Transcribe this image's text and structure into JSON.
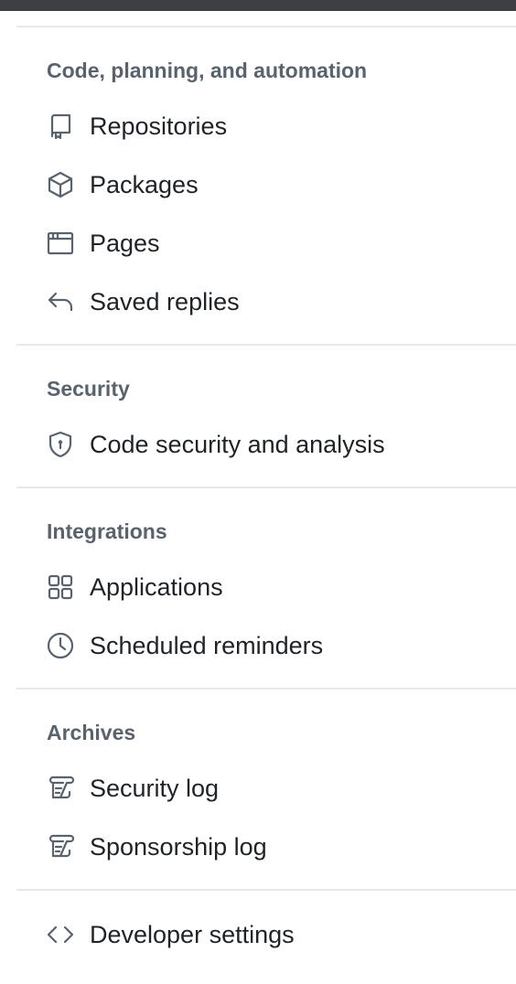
{
  "sections": {
    "code": {
      "heading": "Code, planning, and automation",
      "items": [
        {
          "label": "Repositories",
          "icon": "repo-icon"
        },
        {
          "label": "Packages",
          "icon": "package-icon"
        },
        {
          "label": "Pages",
          "icon": "browser-icon"
        },
        {
          "label": "Saved replies",
          "icon": "reply-icon"
        }
      ]
    },
    "security": {
      "heading": "Security",
      "items": [
        {
          "label": "Code security and analysis",
          "icon": "shield-lock-icon"
        }
      ]
    },
    "integrations": {
      "heading": "Integrations",
      "items": [
        {
          "label": "Applications",
          "icon": "apps-icon"
        },
        {
          "label": "Scheduled reminders",
          "icon": "clock-icon"
        }
      ]
    },
    "archives": {
      "heading": "Archives",
      "items": [
        {
          "label": "Security log",
          "icon": "log-icon"
        },
        {
          "label": "Sponsorship log",
          "icon": "log-icon"
        }
      ]
    },
    "developer": {
      "items": [
        {
          "label": "Developer settings",
          "icon": "code-icon"
        }
      ]
    }
  },
  "colors": {
    "text": "#1f2328",
    "muted": "#59636e",
    "divider": "#e6e8eb",
    "top_bar": "#3d3f43"
  }
}
